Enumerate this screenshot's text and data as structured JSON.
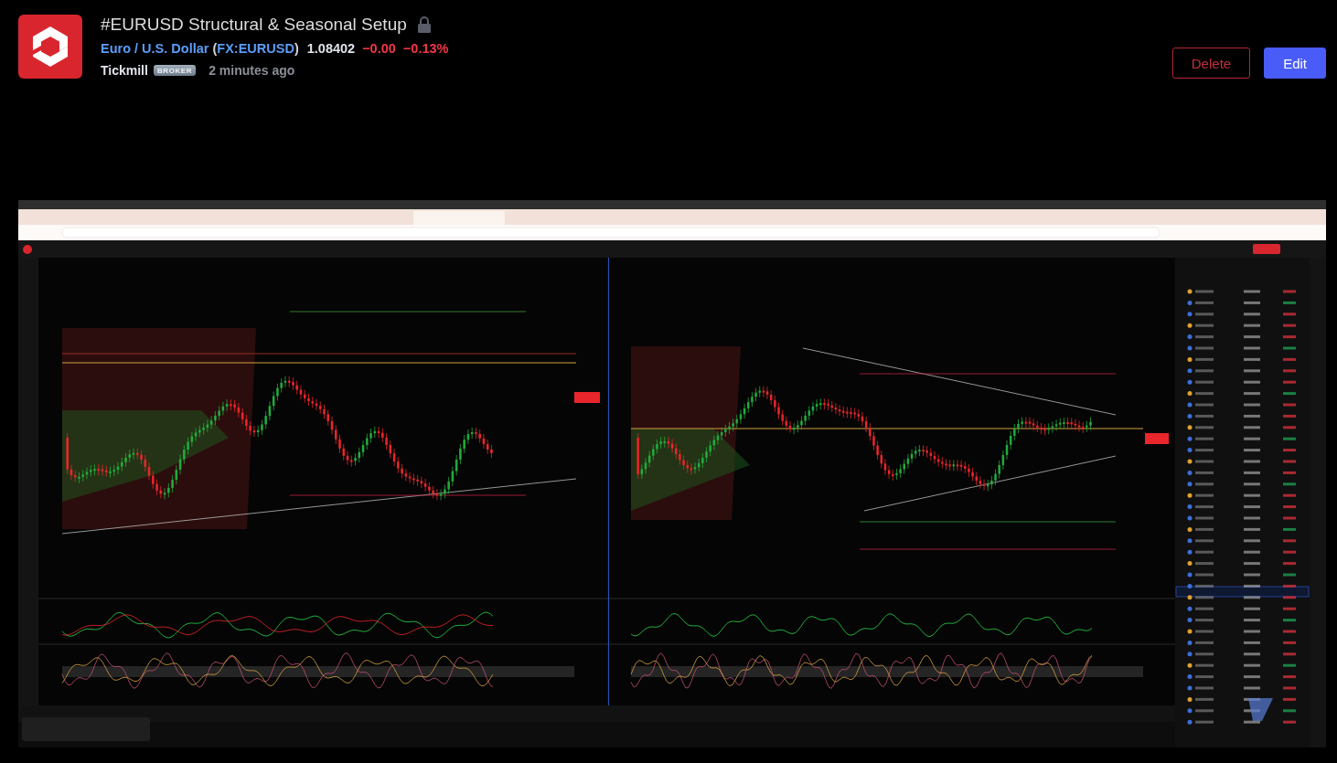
{
  "idea": {
    "title": "#EURUSD Structural & Seasonal Setup",
    "locked": true
  },
  "symbol": {
    "name": "Euro / U.S. Dollar",
    "open_paren": "(",
    "ticker": "FX:EURUSD",
    "close_paren": ")",
    "price": "1.08402",
    "change": "−0.00",
    "change_percent": "−0.13%",
    "negative": true
  },
  "author": {
    "name": "Tickmill",
    "badge": "BROKER",
    "time": "2 minutes ago"
  },
  "buttons": [
    {
      "label": "Delete",
      "kind": "danger"
    },
    {
      "label": "Edit",
      "kind": "primary"
    }
  ]
}
